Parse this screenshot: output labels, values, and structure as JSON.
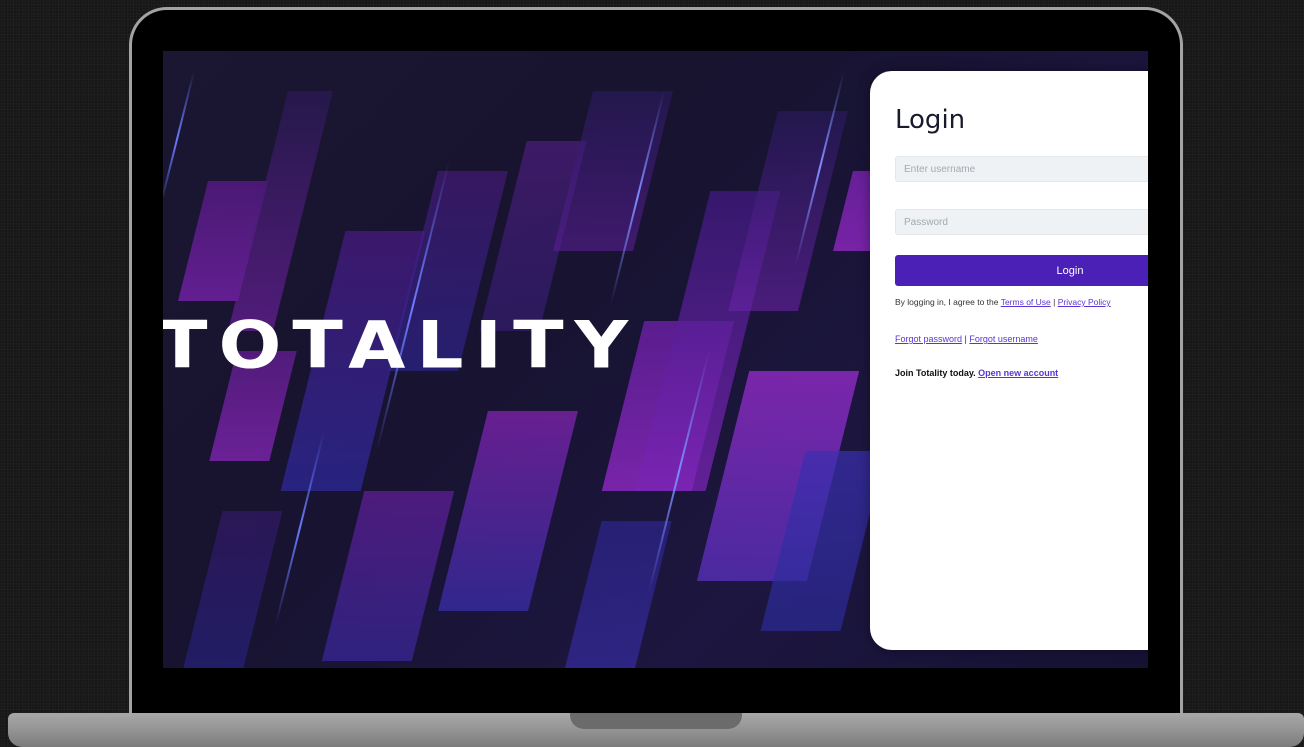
{
  "brand": {
    "logo_text": "TOTALITY"
  },
  "login": {
    "title": "Login",
    "username_placeholder": "Enter username",
    "password_placeholder": "Password",
    "submit_label": "Login",
    "agree_prefix": "By logging in, I agree to the ",
    "terms_label": "Terms of Use",
    "separator": " | ",
    "privacy_label": "Privacy Policy",
    "forgot_password_label": "Forgot password",
    "forgot_username_label": "Forgot username",
    "join_text": "Join Totality today. ",
    "open_account_label": "Open new account"
  },
  "colors": {
    "accent": "#4a20b6",
    "link": "#5b34d6",
    "background": "#171330",
    "streak_purple": "#8a24b8",
    "streak_blue": "#3a2fb0"
  }
}
